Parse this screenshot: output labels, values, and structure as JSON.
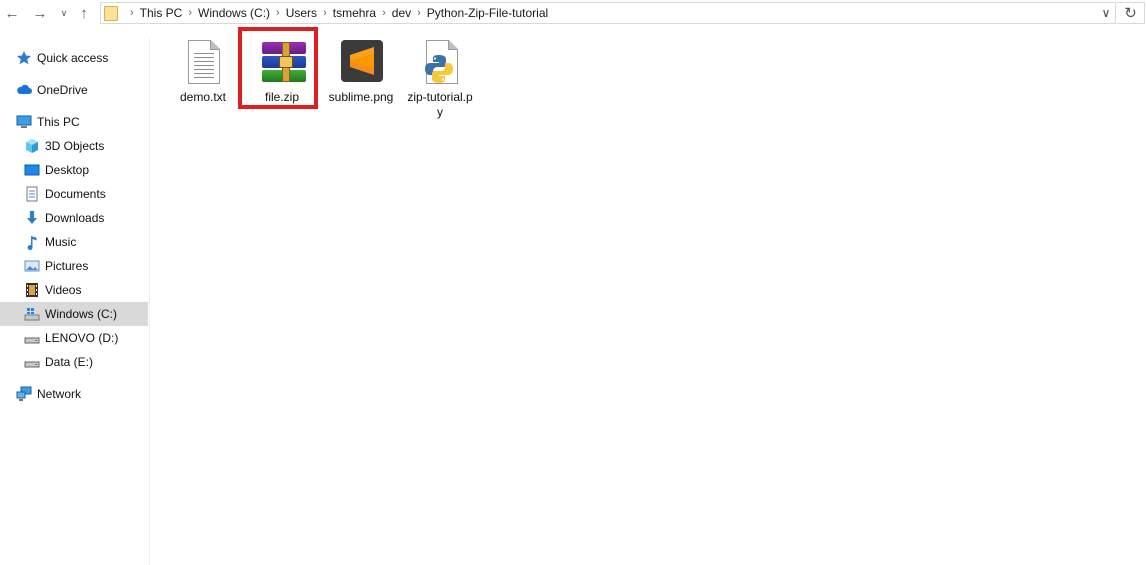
{
  "toolbar": {
    "back_icon": "arrow-left-icon",
    "forward_icon": "arrow-right-icon",
    "recent_icon": "chevron-down-icon",
    "up_icon": "arrow-up-icon",
    "refresh_icon": "refresh-icon"
  },
  "breadcrumb": {
    "items": [
      "This PC",
      "Windows (C:)",
      "Users",
      "tsmehra",
      "dev",
      "Python-Zip-File-tutorial"
    ]
  },
  "sidebar": {
    "items": [
      {
        "label": "Quick access",
        "icon": "star-icon"
      },
      {
        "label": "OneDrive",
        "icon": "cloud-icon"
      },
      {
        "label": "This PC",
        "icon": "computer-icon"
      },
      {
        "label": "3D Objects",
        "icon": "cube-icon"
      },
      {
        "label": "Desktop",
        "icon": "desktop-icon"
      },
      {
        "label": "Documents",
        "icon": "document-icon"
      },
      {
        "label": "Downloads",
        "icon": "download-icon"
      },
      {
        "label": "Music",
        "icon": "music-icon"
      },
      {
        "label": "Pictures",
        "icon": "pictures-icon"
      },
      {
        "label": "Videos",
        "icon": "video-icon"
      },
      {
        "label": "Windows (C:)",
        "icon": "drive-icon",
        "selected": true
      },
      {
        "label": "LENOVO (D:)",
        "icon": "drive-icon"
      },
      {
        "label": "Data (E:)",
        "icon": "drive-icon"
      },
      {
        "label": "Network",
        "icon": "network-icon"
      }
    ]
  },
  "files": [
    {
      "name": "demo.txt",
      "type": "text-file-icon"
    },
    {
      "name": "file.zip",
      "type": "winrar-archive-icon",
      "highlighted": true
    },
    {
      "name": "sublime.png",
      "type": "sublime-image-icon"
    },
    {
      "name": "zip-tutorial.py",
      "type": "python-file-icon"
    }
  ],
  "colors": {
    "highlight": "#e01e1e",
    "selected_bg": "#d9d9d9",
    "folder": "#fbe29a"
  }
}
